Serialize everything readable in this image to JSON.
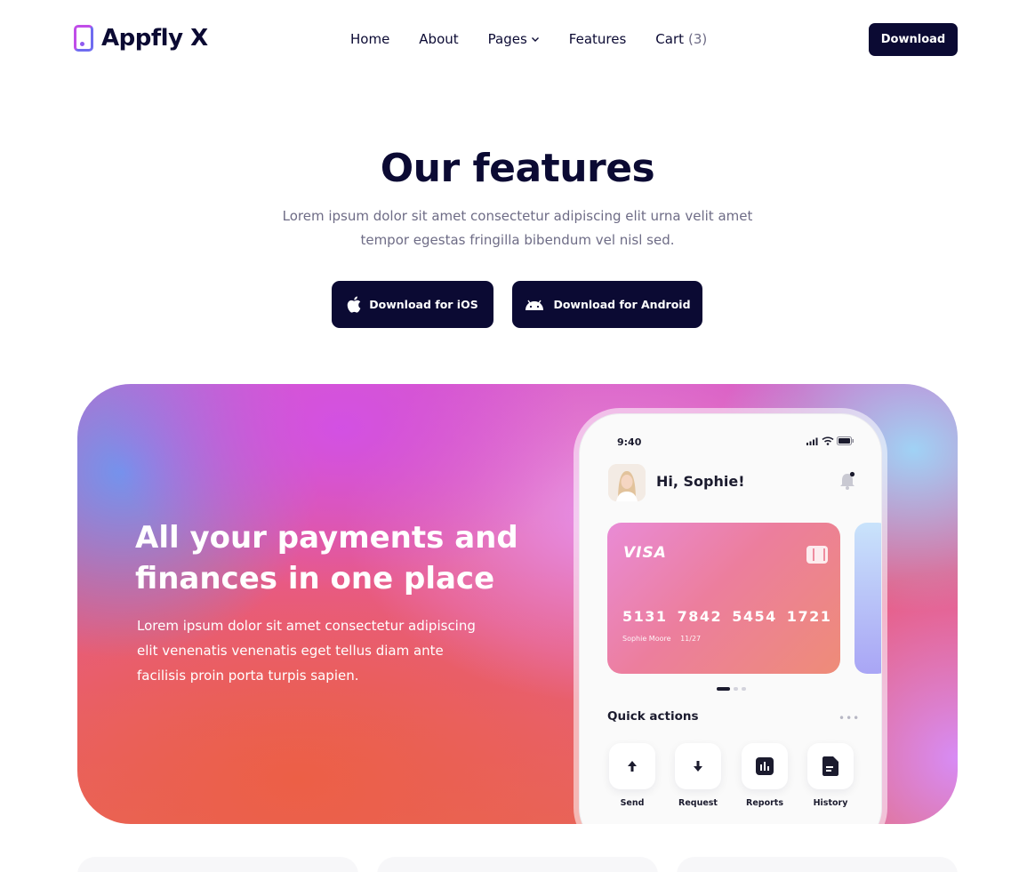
{
  "header": {
    "logo_text": "Appfly X",
    "nav": {
      "home": "Home",
      "about": "About",
      "pages": "Pages",
      "features": "Features",
      "cart": "Cart",
      "cart_count": "(3)"
    },
    "download_label": "Download"
  },
  "hero": {
    "title": "Our features",
    "subtitle": "Lorem ipsum dolor sit amet consectetur adipiscing elit urna velit amet tempor egestas fringilla bibendum vel nisl sed.",
    "ios_button": "Download for iOS",
    "android_button": "Download for Android"
  },
  "banner": {
    "heading": "All your payments and finances in one place",
    "text": "Lorem ipsum dolor sit amet consectetur adipiscing elit venenatis venenatis eget tellus diam ante facilisis proin porta turpis sapien."
  },
  "phone": {
    "time": "9:40",
    "greeting": "Hi, Sophie!",
    "card": {
      "brand": "VISA",
      "number": "5131 7842 5454 1721",
      "holder": "Sophie Moore",
      "expiry": "11/27"
    },
    "quick_actions_title": "Quick actions",
    "more": "•••",
    "actions": [
      {
        "label": "Send",
        "icon": "send-icon"
      },
      {
        "label": "Request",
        "icon": "request-icon"
      },
      {
        "label": "Reports",
        "icon": "reports-icon"
      },
      {
        "label": "History",
        "icon": "history-icon"
      }
    ]
  },
  "colors": {
    "primary": "#0b0a33",
    "muted_text": "#6e6c86",
    "logo_gradient_start": "#c04de8",
    "logo_gradient_end": "#6f6cf0"
  }
}
